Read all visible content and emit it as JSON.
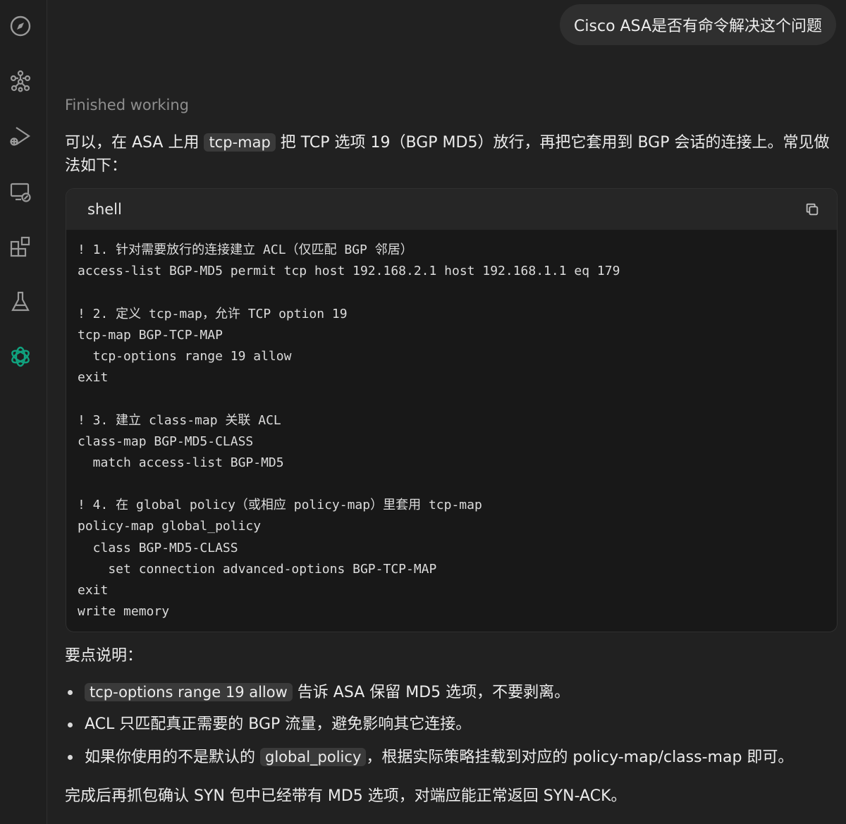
{
  "sidebar": {
    "items": [
      {
        "icon": "compass-icon"
      },
      {
        "icon": "network-icon"
      },
      {
        "icon": "play-debug-icon"
      },
      {
        "icon": "remote-monitor-icon"
      },
      {
        "icon": "extensions-icon"
      },
      {
        "icon": "flask-icon"
      },
      {
        "icon": "chatgpt-logo-icon",
        "color": "#10a37f"
      }
    ]
  },
  "chat": {
    "user_message": "Cisco ASA是否有命令解决这个问题",
    "status": "Finished working",
    "intro": {
      "before": "可以，在 ASA 上用 ",
      "code": "tcp-map",
      "after": " 把 TCP 选项 19（BGP MD5）放行，再把它套用到 BGP 会话的连接上。常见做法如下："
    },
    "code_block": {
      "language": "shell",
      "copy_icon": "copy-icon",
      "lines": [
        "! 1. 针对需要放行的连接建立 ACL（仅匹配 BGP 邻居）",
        "access-list BGP-MD5 permit tcp host 192.168.2.1 host 192.168.1.1 eq 179",
        "",
        "! 2. 定义 tcp-map，允许 TCP option 19",
        "tcp-map BGP-TCP-MAP",
        "  tcp-options range 19 allow",
        "exit",
        "",
        "! 3. 建立 class-map 关联 ACL",
        "class-map BGP-MD5-CLASS",
        "  match access-list BGP-MD5",
        "",
        "! 4. 在 global policy（或相应 policy-map）里套用 tcp-map",
        "policy-map global_policy",
        "  class BGP-MD5-CLASS",
        "    set connection advanced-options BGP-TCP-MAP",
        "exit",
        "write memory"
      ]
    },
    "points_title": "要点说明：",
    "bullets": [
      {
        "before": "",
        "code": "tcp-options range 19 allow",
        "after": " 告诉 ASA 保留 MD5 选项，不要剥离。"
      },
      {
        "before": "ACL 只匹配真正需要的 BGP 流量，避免影响其它连接。",
        "code": "",
        "after": ""
      },
      {
        "before": "如果你使用的不是默认的 ",
        "code": "global_policy",
        "after": "，根据实际策略挂载到对应的 policy-map/class-map 即可。"
      }
    ],
    "final": "完成后再抓包确认 SYN 包中已经带有 MD5 选项，对端应能正常返回 SYN-ACK。"
  }
}
